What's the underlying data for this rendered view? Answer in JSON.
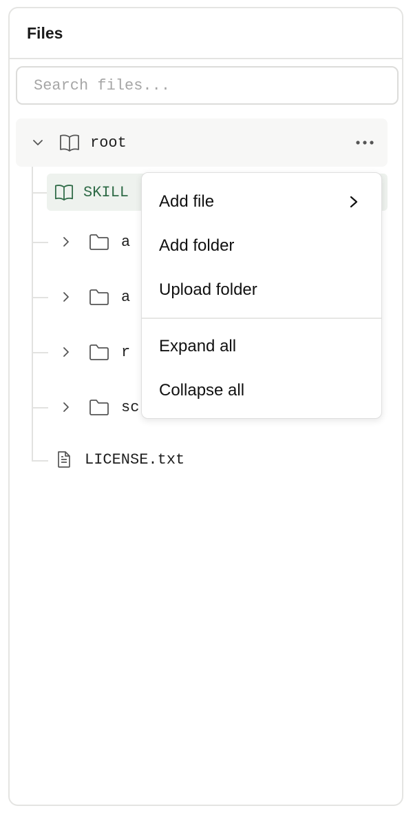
{
  "panel": {
    "title": "Files"
  },
  "search": {
    "placeholder": "Search files..."
  },
  "tree": {
    "root": {
      "label": "root"
    },
    "skill_file": {
      "label": "SKILL"
    },
    "folders": [
      {
        "label": "a"
      },
      {
        "label": "a"
      },
      {
        "label": "r"
      },
      {
        "label": "scripts/"
      }
    ],
    "license": {
      "label": "LICENSE.txt"
    }
  },
  "context_menu": {
    "items": [
      {
        "label": "Add file",
        "has_submenu": true
      },
      {
        "label": "Add folder"
      },
      {
        "label": "Upload folder"
      },
      {
        "label": "Expand all"
      },
      {
        "label": "Collapse all"
      }
    ]
  },
  "colors": {
    "accent_green": "#2f6b47",
    "selected_bg": "#eef2ee",
    "border": "#e4e4e2"
  },
  "icons": {
    "root": "book-open-icon",
    "skill": "book-open-icon",
    "folder": "folder-icon",
    "file": "file-text-icon",
    "expand": "chevron-right-icon",
    "collapse": "chevron-down-icon",
    "more": "more-horizontal-icon"
  }
}
